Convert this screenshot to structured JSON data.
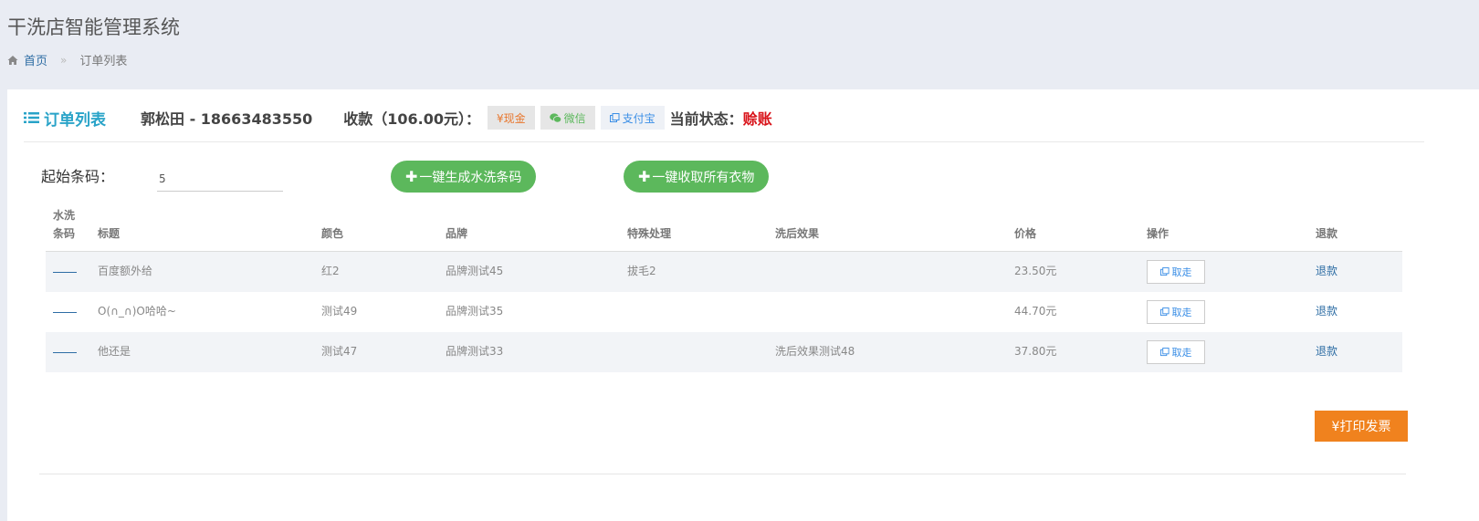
{
  "app": {
    "title": "干洗店智能管理系统"
  },
  "breadcrumb": {
    "home": "首页",
    "current": "订单列表"
  },
  "panel": {
    "title": "订单列表",
    "customer": "郭松田 - 18663483550",
    "payment_label": "收款（106.00元）：",
    "pay_buttons": {
      "cash": "¥现金",
      "wechat": "微信",
      "alipay": "支付宝"
    },
    "status_label": "当前状态：",
    "status_value": "赊账"
  },
  "controls": {
    "barcode_label": "起始条码：",
    "barcode_value": "5",
    "generate_label": "一键生成水洗条码",
    "collect_label": "一键收取所有衣物"
  },
  "table": {
    "headers": {
      "code_line1": "水洗",
      "code_line2": "条码",
      "title": "标题",
      "color": "颜色",
      "brand": "品牌",
      "special": "特殊处理",
      "effect": "洗后效果",
      "price": "价格",
      "action": "操作",
      "refund": "退款"
    },
    "rows": [
      {
        "title": "百度额外给",
        "color": "红2",
        "brand": "品牌测试45",
        "special": "拔毛2",
        "effect": "",
        "price": "23.50元",
        "action": "取走",
        "refund": "退款"
      },
      {
        "title": "O(∩_∩)O哈哈~",
        "color": "测试49",
        "brand": "品牌测试35",
        "special": "",
        "effect": "",
        "price": "44.70元",
        "action": "取走",
        "refund": "退款"
      },
      {
        "title": "他还是",
        "color": "测试47",
        "brand": "品牌测试33",
        "special": "",
        "effect": "洗后效果测试48",
        "price": "37.80元",
        "action": "取走",
        "refund": "退款"
      }
    ]
  },
  "footer": {
    "print_label": "¥打印发票"
  },
  "colors": {
    "accent": "#29a3c8",
    "green": "#5cb85c",
    "orange": "#f0821e",
    "status_red": "#d9141b",
    "link_blue": "#2e6da4"
  }
}
